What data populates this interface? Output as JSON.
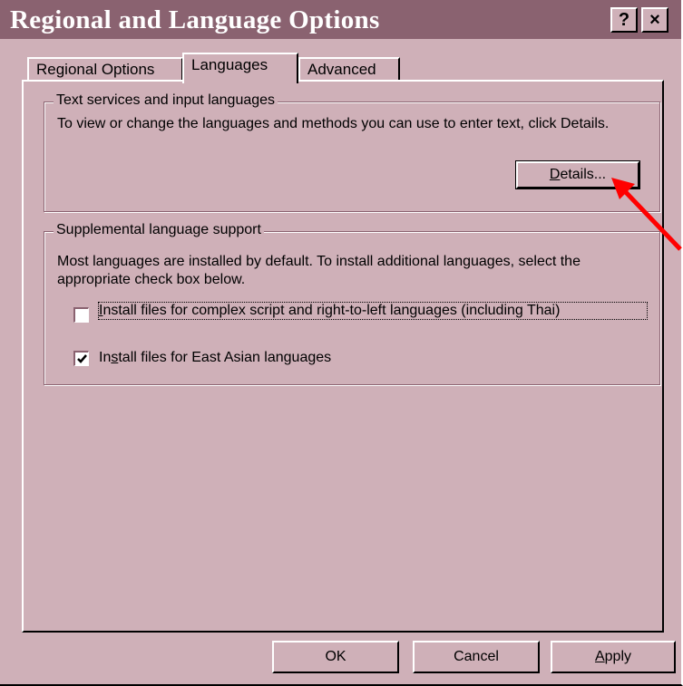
{
  "window": {
    "title": "Regional and Language Options"
  },
  "title_buttons": {
    "help": "?",
    "close": "×"
  },
  "tabs": [
    {
      "label": "Regional Options"
    },
    {
      "label": "Languages"
    },
    {
      "label": "Advanced"
    }
  ],
  "text_services": {
    "legend": "Text services and input languages",
    "description": "To view or change the languages and methods you can use to enter text, click Details.",
    "details_button": {
      "mnemonic": "D",
      "rest": "etails..."
    }
  },
  "supplemental": {
    "legend": "Supplemental language support",
    "description": "Most languages are installed by default. To install additional languages, select the appropriate check box below.",
    "complex_script": {
      "checked": false,
      "prefix": "",
      "mnemonic": "I",
      "rest": "nstall files for complex script and right-to-left languages (including Thai)"
    },
    "east_asian": {
      "checked": true,
      "prefix": "In",
      "mnemonic": "s",
      "rest": "tall files for East Asian languages"
    }
  },
  "footer": {
    "ok": "OK",
    "cancel": "Cancel",
    "apply": {
      "mnemonic": "A",
      "rest": "pply"
    }
  },
  "colors": {
    "face": "#cfb0b8",
    "titlebar": "#8a6270",
    "annotation_arrow": "#ff0000"
  }
}
